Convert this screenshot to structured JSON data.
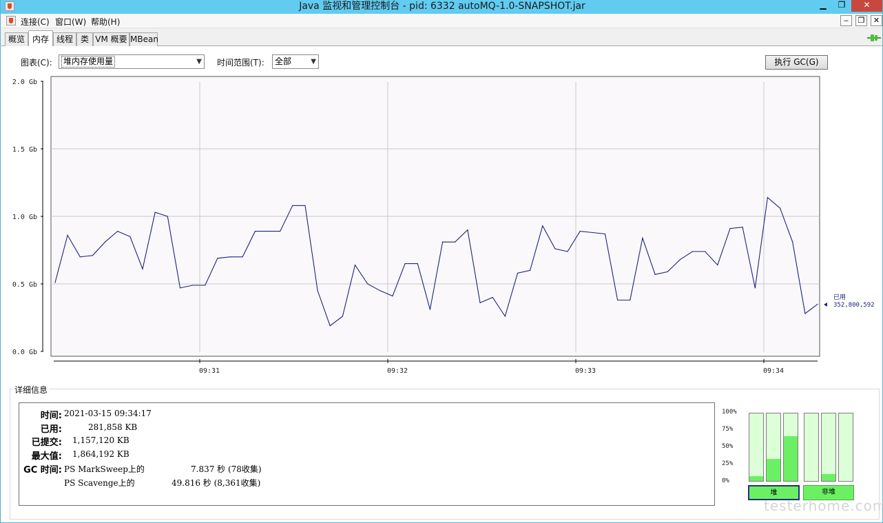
{
  "window": {
    "title": "Java 监视和管理控制台 - pid: 6332 autoMQ-1.0-SNAPSHOT.jar",
    "minimize": "▁",
    "maximize": "❐",
    "close": "✕"
  },
  "menu": {
    "items": [
      "连接(C)",
      "窗口(W)",
      "帮助(H)"
    ],
    "mdi_min": "‒",
    "mdi_restore": "❐",
    "mdi_close": "✕"
  },
  "tabs": [
    "概览",
    "内存",
    "线程",
    "类",
    "VM 概要",
    "MBean"
  ],
  "active_tab": "内存",
  "controls": {
    "chart_label": "图表(C):",
    "chart_value": "堆内存使用量",
    "range_label": "时间范围(T):",
    "range_value": "全部",
    "gc_button": "执行 GC(G)"
  },
  "chart_data": {
    "type": "line",
    "y_tick_labels": [
      "2.0 Gb",
      "1.5 Gb",
      "1.0 Gb",
      "0.5 Gb",
      "0.0 Gb"
    ],
    "x_tick_labels": [
      "09:31",
      "09:32",
      "09:33",
      "09:34"
    ],
    "ylim": [
      0,
      2.0
    ],
    "series": [
      {
        "values": [
          0.51,
          0.86,
          0.7,
          0.71,
          0.81,
          0.89,
          0.85,
          0.61,
          1.03,
          1.0,
          0.47,
          0.49,
          0.49,
          0.69,
          0.7,
          0.7,
          0.89,
          0.89,
          0.89,
          1.08,
          1.08,
          0.45,
          0.19,
          0.26,
          0.64,
          0.5,
          0.45,
          0.41,
          0.65,
          0.65,
          0.31,
          0.81,
          0.81,
          0.9,
          0.36,
          0.4,
          0.26,
          0.58,
          0.6,
          0.93,
          0.76,
          0.74,
          0.89,
          0.88,
          0.87,
          0.38,
          0.38,
          0.84,
          0.57,
          0.59,
          0.68,
          0.74,
          0.74,
          0.64,
          0.91,
          0.92,
          0.47,
          1.14,
          1.06,
          0.81,
          0.28,
          0.35
        ]
      }
    ],
    "current_label": "已用",
    "current_value": "352,800,592",
    "line_color": "#1a237e"
  },
  "details": {
    "title": "详细信息",
    "rows": [
      {
        "label": "时间:",
        "value": "2021-03-15 09:34:17"
      },
      {
        "label": "已用:",
        "value": "281,858 KB"
      },
      {
        "label": "已提交:",
        "value": "1,157,120 KB"
      },
      {
        "label": "最大值:",
        "value": "1,864,192 KB"
      }
    ],
    "gc_label": "GC 时间:",
    "gc_rows": [
      {
        "name": "PS MarkSweep上的",
        "value": "7.837 秒 (78收集)"
      },
      {
        "name": "PS Scavenge上的",
        "value": "49.816 秒 (8,361收集)"
      }
    ]
  },
  "pools": {
    "pct_labels": [
      "100%",
      "75%",
      "50%",
      "25%",
      "0%"
    ],
    "heap_fills": [
      0.07,
      0.33,
      0.66
    ],
    "nonheap_fills": [
      0.0,
      0.1,
      0.0
    ],
    "heap_label": "堆",
    "nonheap_label": "非堆",
    "fill_color": "#6cf063"
  },
  "watermark": "testerhome.com"
}
